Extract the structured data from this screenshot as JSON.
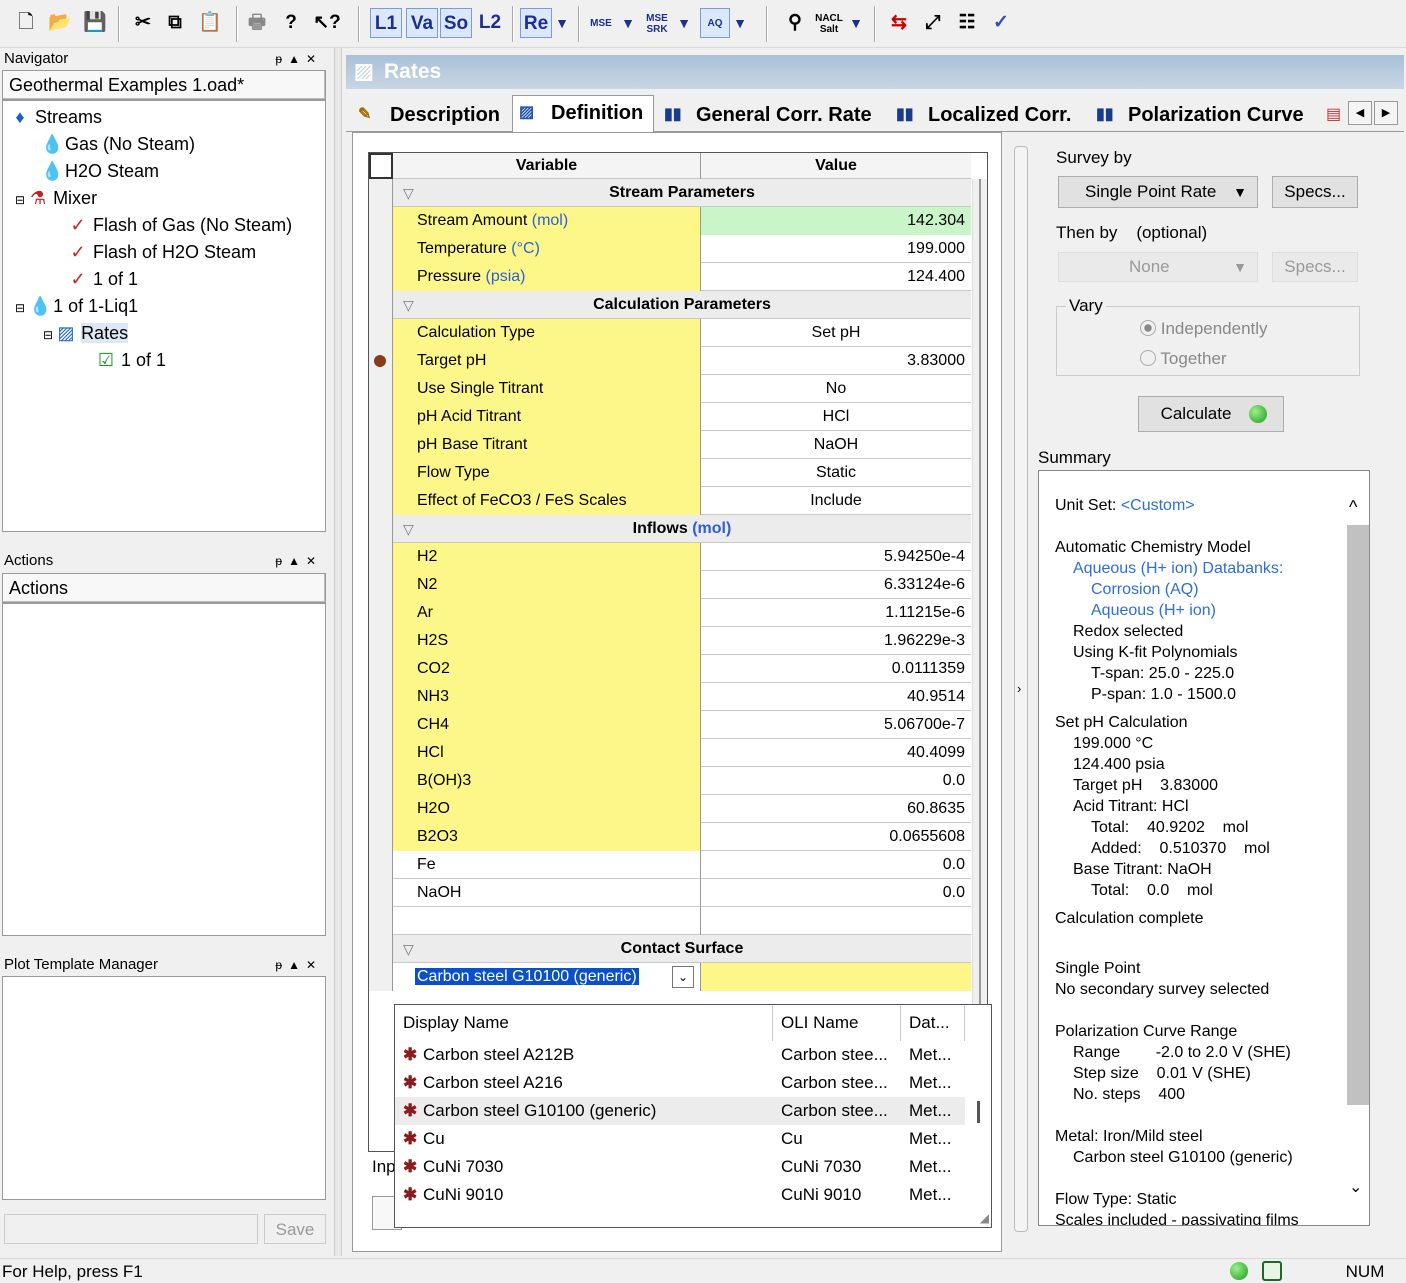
{
  "toolbar": {
    "l1": "L1",
    "va": "Va",
    "so": "So",
    "l2": "L2",
    "re": "Re",
    "mse": "MSE",
    "mse_srk": "MSE SRK",
    "aq": "AQ",
    "nacl": "NACL Salt"
  },
  "navigator": {
    "title": "Navigator",
    "file": "Geothermal Examples 1.oad*",
    "tree": {
      "streams": "Streams",
      "gas": "Gas (No Steam)",
      "h2o": "H2O Steam",
      "mixer": "Mixer",
      "flash_gas": "Flash of Gas (No Steam)",
      "flash_h2o": "Flash of H2O Steam",
      "one_of_one": "1 of 1",
      "liq": "1 of 1-Liq1",
      "rates": "Rates",
      "rates_child": "1 of 1"
    }
  },
  "actions": {
    "title": "Actions",
    "subtitle": "Actions"
  },
  "plot_manager": {
    "title": "Plot Template Manager",
    "save": "Save"
  },
  "rates": {
    "title": "Rates"
  },
  "tabs": {
    "description": "Description",
    "definition": "Definition",
    "general": "General Corr. Rate",
    "localized": "Localized Corr.",
    "polarization": "Polarization Curve"
  },
  "grid": {
    "col_variable": "Variable",
    "col_value": "Value",
    "stream_params": "Stream Parameters",
    "stream_amount": "Stream Amount",
    "stream_amount_unit": "(mol)",
    "stream_amount_val": "142.304",
    "temperature": "Temperature",
    "temperature_unit": "(°C)",
    "temperature_val": "199.000",
    "pressure": "Pressure",
    "pressure_unit": "(psia)",
    "pressure_val": "124.400",
    "calc_params": "Calculation Parameters",
    "calc_type": "Calculation Type",
    "calc_type_val": "Set pH",
    "target_ph": "Target pH",
    "target_ph_val": "3.83000",
    "single_titrant": "Use Single Titrant",
    "single_titrant_val": "No",
    "acid_titrant": "pH Acid Titrant",
    "acid_titrant_val": "HCl",
    "base_titrant": "pH Base Titrant",
    "base_titrant_val": "NaOH",
    "flow_type": "Flow Type",
    "flow_type_val": "Static",
    "scales": "Effect of FeCO3 / FeS Scales",
    "scales_val": "Include",
    "inflows": "Inflows",
    "inflows_unit": "(mol)",
    "inflow_rows": [
      {
        "name": "H2",
        "value": "5.94250e-4",
        "yellow": true
      },
      {
        "name": "N2",
        "value": "6.33124e-6",
        "yellow": true
      },
      {
        "name": "Ar",
        "value": "1.11215e-6",
        "yellow": true
      },
      {
        "name": "H2S",
        "value": "1.96229e-3",
        "yellow": true
      },
      {
        "name": "CO2",
        "value": "0.0111359",
        "yellow": true
      },
      {
        "name": "NH3",
        "value": "40.9514",
        "yellow": true
      },
      {
        "name": "CH4",
        "value": "5.06700e-7",
        "yellow": true
      },
      {
        "name": "HCl",
        "value": "40.4099",
        "yellow": true
      },
      {
        "name": "B(OH)3",
        "value": "0.0",
        "yellow": true
      },
      {
        "name": "H2O",
        "value": "60.8635",
        "yellow": true
      },
      {
        "name": "B2O3",
        "value": "0.0655608",
        "yellow": true
      },
      {
        "name": "Fe",
        "value": "0.0",
        "yellow": false
      },
      {
        "name": "NaOH",
        "value": "0.0",
        "yellow": false
      }
    ],
    "contact_surface": "Contact Surface",
    "contact_value": "Carbon steel G10100 (generic)"
  },
  "dropdown": {
    "col_display": "Display Name",
    "col_oli": "OLI Name",
    "col_dat": "Dat...",
    "rows": [
      {
        "display": "Carbon steel A212B",
        "oli": "Carbon stee...",
        "dat": "Met..."
      },
      {
        "display": "Carbon steel A216",
        "oli": "Carbon stee...",
        "dat": "Met..."
      },
      {
        "display": "Carbon steel G10100 (generic)",
        "oli": "Carbon stee...",
        "dat": "Met..."
      },
      {
        "display": "Cu",
        "oli": "Cu",
        "dat": "Met..."
      },
      {
        "display": "CuNi 7030",
        "oli": "CuNi 7030",
        "dat": "Met..."
      },
      {
        "display": "CuNi 9010",
        "oli": "CuNi 9010",
        "dat": "Met..."
      }
    ],
    "behind_text": "Inp"
  },
  "right": {
    "survey_by": "Survey by",
    "survey_value": "Single Point Rate",
    "specs": "Specs...",
    "then_by": "Then by    (optional)",
    "then_value": "None",
    "vary": "Vary",
    "independently": "Independently",
    "together": "Together",
    "calculate": "Calculate",
    "summary": "Summary"
  },
  "summary_lines": [
    {
      "text": "Unit Set: ",
      "extra": "<Custom>"
    },
    {
      "text": "Automatic Chemistry Model"
    },
    {
      "text": "Aqueous (H+ ion) Databanks:"
    },
    {
      "text": "Corrosion (AQ)"
    },
    {
      "text": "Aqueous (H+ ion)"
    },
    {
      "text": "Redox selected"
    },
    {
      "text": "Using K-fit Polynomials"
    },
    {
      "text": "T-span: 25.0 - 225.0"
    },
    {
      "text": "P-span: 1.0 - 1500.0"
    },
    {
      "text": "Set pH Calculation"
    },
    {
      "text": "199.000 °C"
    },
    {
      "text": "124.400 psia"
    },
    {
      "text": "Target pH    3.83000"
    },
    {
      "text": "Acid Titrant: HCl"
    },
    {
      "text": "Total:    40.9202    mol"
    },
    {
      "text": "Added:    0.510370    mol"
    },
    {
      "text": "Base Titrant: NaOH"
    },
    {
      "text": "Total:    0.0    mol"
    },
    {
      "text": "Calculation complete"
    },
    {
      "text": "Single Point"
    },
    {
      "text": "No secondary survey selected"
    },
    {
      "text": "Polarization Curve Range"
    },
    {
      "text": "Range        -2.0 to 2.0 V (SHE)"
    },
    {
      "text": "Step size    0.01 V (SHE)"
    },
    {
      "text": "No. steps    400"
    },
    {
      "text": "Metal: Iron/Mild steel"
    },
    {
      "text": "Carbon steel G10100 (generic)"
    },
    {
      "text": "Flow Type: Static"
    },
    {
      "text": "Scales included - passivating films"
    }
  ],
  "status": {
    "help": "For Help, press F1",
    "num": "NUM"
  }
}
